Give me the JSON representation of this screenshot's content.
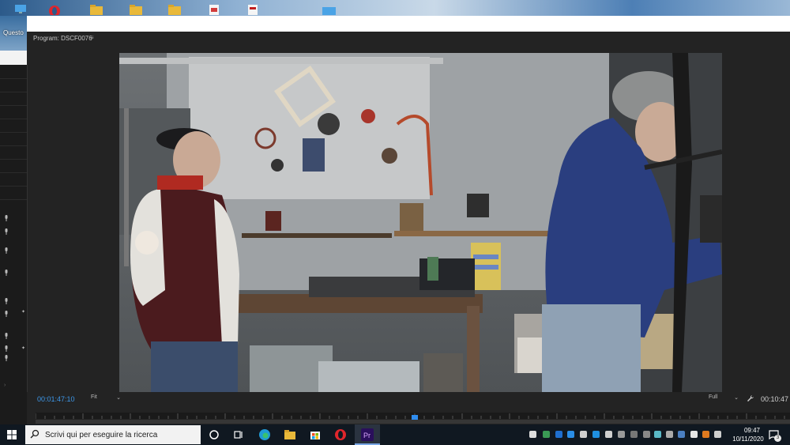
{
  "desktop": {
    "icon_label": "Questo"
  },
  "panel": {
    "title": "Program: DSCF0076",
    "menu_glyph": "≡"
  },
  "playback": {
    "current_timecode": "00:01:47:10",
    "zoom": "Fit",
    "resolution": "Full",
    "duration": "00:10:47"
  },
  "taskbar": {
    "search_placeholder": "Scrivi qui per eseguire la ricerca",
    "time": "09:47",
    "date": "10/11/2020",
    "notification_count": "3"
  },
  "colors": {
    "timecode_blue": "#3d97e8",
    "playhead_blue": "#2f8df0",
    "premiere_purple": "#2a0f5c"
  }
}
